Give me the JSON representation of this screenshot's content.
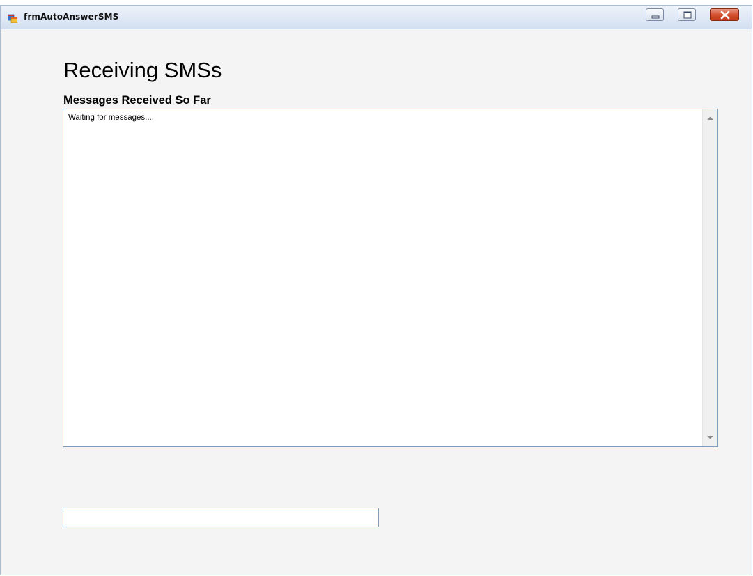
{
  "window": {
    "title": "frmAutoAnswerSMS"
  },
  "main": {
    "heading": "Receiving SMSs",
    "subheading": "Messages Received So Far",
    "messages_text": "Waiting for messages....",
    "input_value": "",
    "input_placeholder": ""
  },
  "icons": {
    "app": "application-window-icon",
    "minimize": "minimize-icon",
    "maximize": "maximize-icon",
    "close": "close-icon",
    "scroll_up": "scroll-up-arrow-icon",
    "scroll_down": "scroll-down-arrow-icon"
  },
  "colors": {
    "close_button": "#c8411c",
    "border": "#7f9db9",
    "background": "#f4f4f4"
  }
}
